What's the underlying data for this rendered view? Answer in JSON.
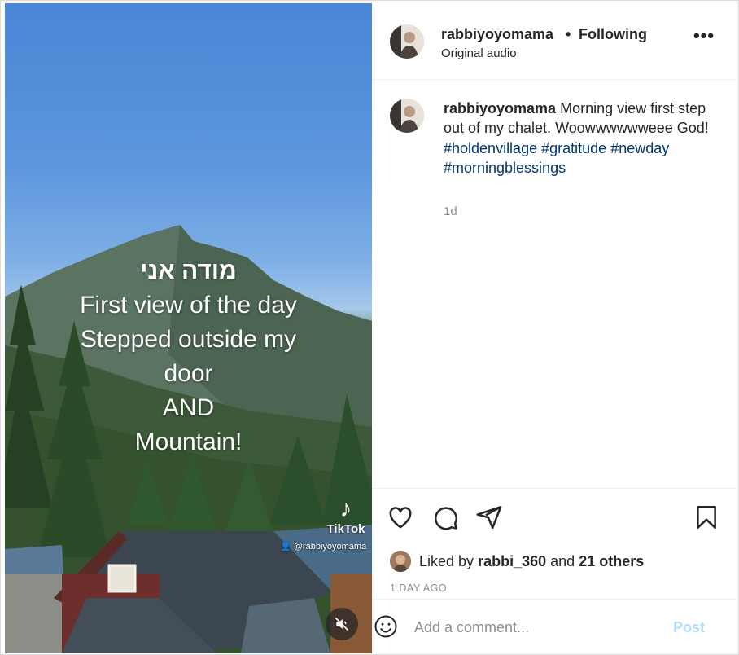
{
  "media": {
    "overlay_lines": [
      "מודה אני",
      "First view of the day",
      "Stepped outside my",
      "door",
      "AND",
      "Mountain!"
    ],
    "watermark_brand": "TikTok",
    "watermark_handle": "@rabbiyoyomama",
    "mute_icon": "speaker-muted-icon"
  },
  "header": {
    "username": "rabbiyoyomama",
    "separator": "•",
    "follow_status": "Following",
    "audio_label": "Original audio",
    "more_icon": "more-options-icon"
  },
  "caption": {
    "username": "rabbiyoyomama",
    "text": "Morning view first step out of my chalet. Woowwwwwweee God!",
    "hashtags": [
      "#holdenvillage",
      "#gratitude",
      "#newday",
      "#morningblessings"
    ],
    "time_ago": "1d"
  },
  "actions": {
    "like_icon": "heart-icon",
    "comment_icon": "comment-icon",
    "share_icon": "paper-plane-icon",
    "save_icon": "bookmark-icon"
  },
  "likes": {
    "prefix": "Liked by",
    "first_liker": "rabbi_360",
    "connector": "and",
    "others": "21 others"
  },
  "post_date": "1 DAY AGO",
  "comment": {
    "placeholder": "Add a comment...",
    "post_label": "Post",
    "emoji_icon": "emoji-icon"
  },
  "colors": {
    "hashtag": "#00376b",
    "post_disabled": "#b2dffc",
    "muted_text": "#8e8e8e"
  }
}
